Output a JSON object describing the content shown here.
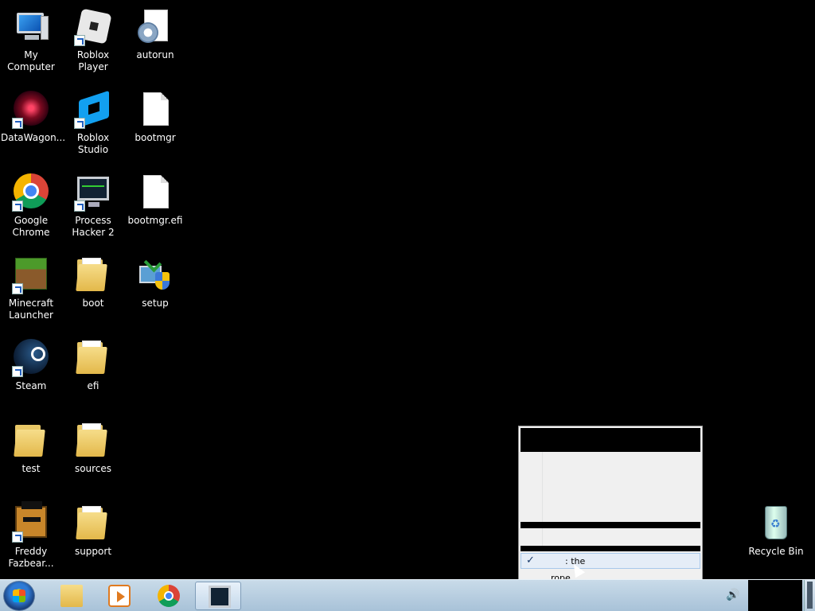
{
  "desktop": {
    "icons": [
      {
        "label": "My Computer",
        "icon": "computer-icon"
      },
      {
        "label": "Roblox Player",
        "icon": "roblox-player-icon"
      },
      {
        "label": "autorun",
        "icon": "settings-file-icon"
      },
      {
        "label": "DataWagon...",
        "icon": "datawagon-icon"
      },
      {
        "label": "Roblox Studio",
        "icon": "roblox-studio-icon"
      },
      {
        "label": "bootmgr",
        "icon": "blank-file-icon"
      },
      {
        "label": "Google Chrome",
        "icon": "chrome-icon"
      },
      {
        "label": "Process Hacker 2",
        "icon": "process-hacker-icon"
      },
      {
        "label": "bootmgr.efi",
        "icon": "blank-file-icon"
      },
      {
        "label": "Minecraft Launcher",
        "icon": "minecraft-icon"
      },
      {
        "label": "boot",
        "icon": "folder-icon"
      },
      {
        "label": "setup",
        "icon": "setup-icon"
      },
      {
        "label": "Steam",
        "icon": "steam-icon"
      },
      {
        "label": "efi",
        "icon": "folder-icon"
      },
      {
        "label": "test",
        "icon": "folder-icon"
      },
      {
        "label": "sources",
        "icon": "folder-icon"
      },
      {
        "label": "Freddy Fazbear...",
        "icon": "freddy-icon"
      },
      {
        "label": "support",
        "icon": "folder-icon"
      },
      {
        "label": "Recycle Bin",
        "icon": "recycle-bin-icon"
      }
    ]
  },
  "popup_menu": {
    "checked_item_label": ": the",
    "check_mark": "✓",
    "second_item_label": "rope"
  },
  "taskbar": {
    "pinned": [
      "start-orb",
      "windows-explorer",
      "media-player",
      "google-chrome",
      "process-hacker"
    ],
    "tray_volume_glyph": "🔊"
  },
  "colors": {
    "desktop_background": "#000000",
    "taskbar": "#b8cde0",
    "menu_background": "#f0f0f0",
    "menu_highlight": "#e5edf7"
  }
}
